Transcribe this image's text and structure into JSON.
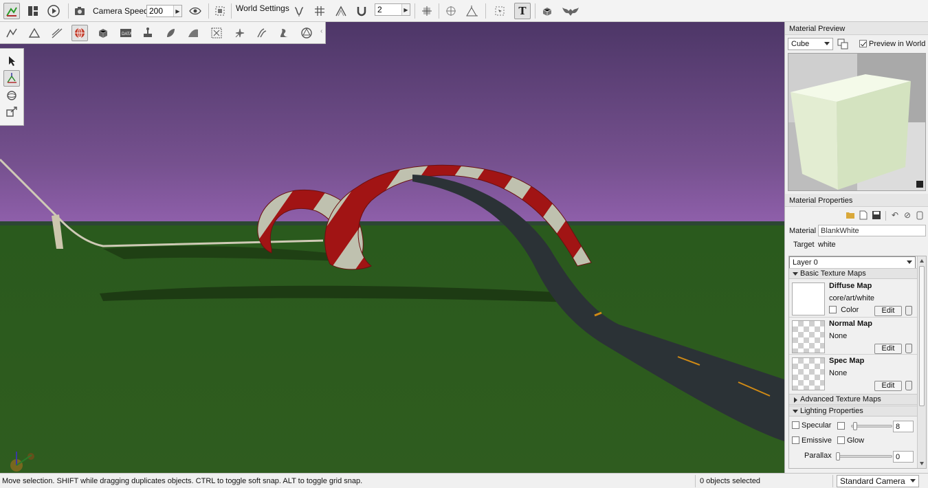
{
  "toolbar": {
    "camera_speed_label": "Camera Speed",
    "camera_speed_value": "200",
    "world_settings_label": "World Settings",
    "snap_value": "2",
    "text_tool_label": "T"
  },
  "status_bar": {
    "hint": "Move selection.  SHIFT while dragging duplicates objects.  CTRL to toggle soft snap.  ALT to toggle grid snap.",
    "selection_count": "0 objects selected",
    "camera_mode": "Standard Camera"
  },
  "material_preview": {
    "header": "Material Preview",
    "shape": "Cube",
    "preview_in_world_label": "Preview in World",
    "preview_in_world_checked": true
  },
  "material_properties": {
    "header": "Material Properties",
    "material_label": "Material",
    "material_value": "BlankWhite",
    "target_label": "Target",
    "target_value": "white",
    "layer": "Layer 0",
    "basic_section": "Basic Texture Maps",
    "advanced_section": "Advanced Texture Maps",
    "lighting_section": "Lighting Properties",
    "edit_label": "Edit",
    "diffuse": {
      "title": "Diffuse Map",
      "value": "core/art/white",
      "color_label": "Color"
    },
    "normal": {
      "title": "Normal Map",
      "value": "None"
    },
    "spec": {
      "title": "Spec Map",
      "value": "None"
    },
    "lighting": {
      "specular_label": "Specular",
      "specular_value": "8",
      "emissive_label": "Emissive",
      "glow_label": "Glow",
      "parallax_label": "Parallax",
      "parallax_value": "0"
    }
  },
  "icons": {
    "top_toolbar": [
      "world-editor-icon",
      "gui-editor-icon",
      "play-icon",
      "camera-icon",
      "eye-icon",
      "fit-view-icon",
      "terrain-snap-icon",
      "grid-icon",
      "bounds-icon",
      "magnet-icon",
      "object-center-icon",
      "world-center-icon",
      "axis-icon",
      "select-icon",
      "text-icon",
      "prefab-icon",
      "bat-icon"
    ],
    "palette": [
      "object-icon",
      "terrain-icon",
      "road-icon",
      "sphere-icon",
      "cube-icon",
      "datablock-icon",
      "river-icon",
      "forest-icon",
      "mesh-road-icon",
      "decal-icon",
      "particle-icon",
      "terrain-paint-icon",
      "paint-icon",
      "convex-icon"
    ],
    "tools": [
      "select-arrow-icon",
      "move-tool-icon",
      "rotate-tool-icon",
      "scale-tool-icon"
    ]
  },
  "colors": {
    "sky_top": "#513a6c",
    "sky_bottom": "#8a5aa8",
    "ground": "#2e5a1f",
    "track_red": "#a31616",
    "track_white": "#c2c4b3",
    "road": "#2c3236"
  }
}
